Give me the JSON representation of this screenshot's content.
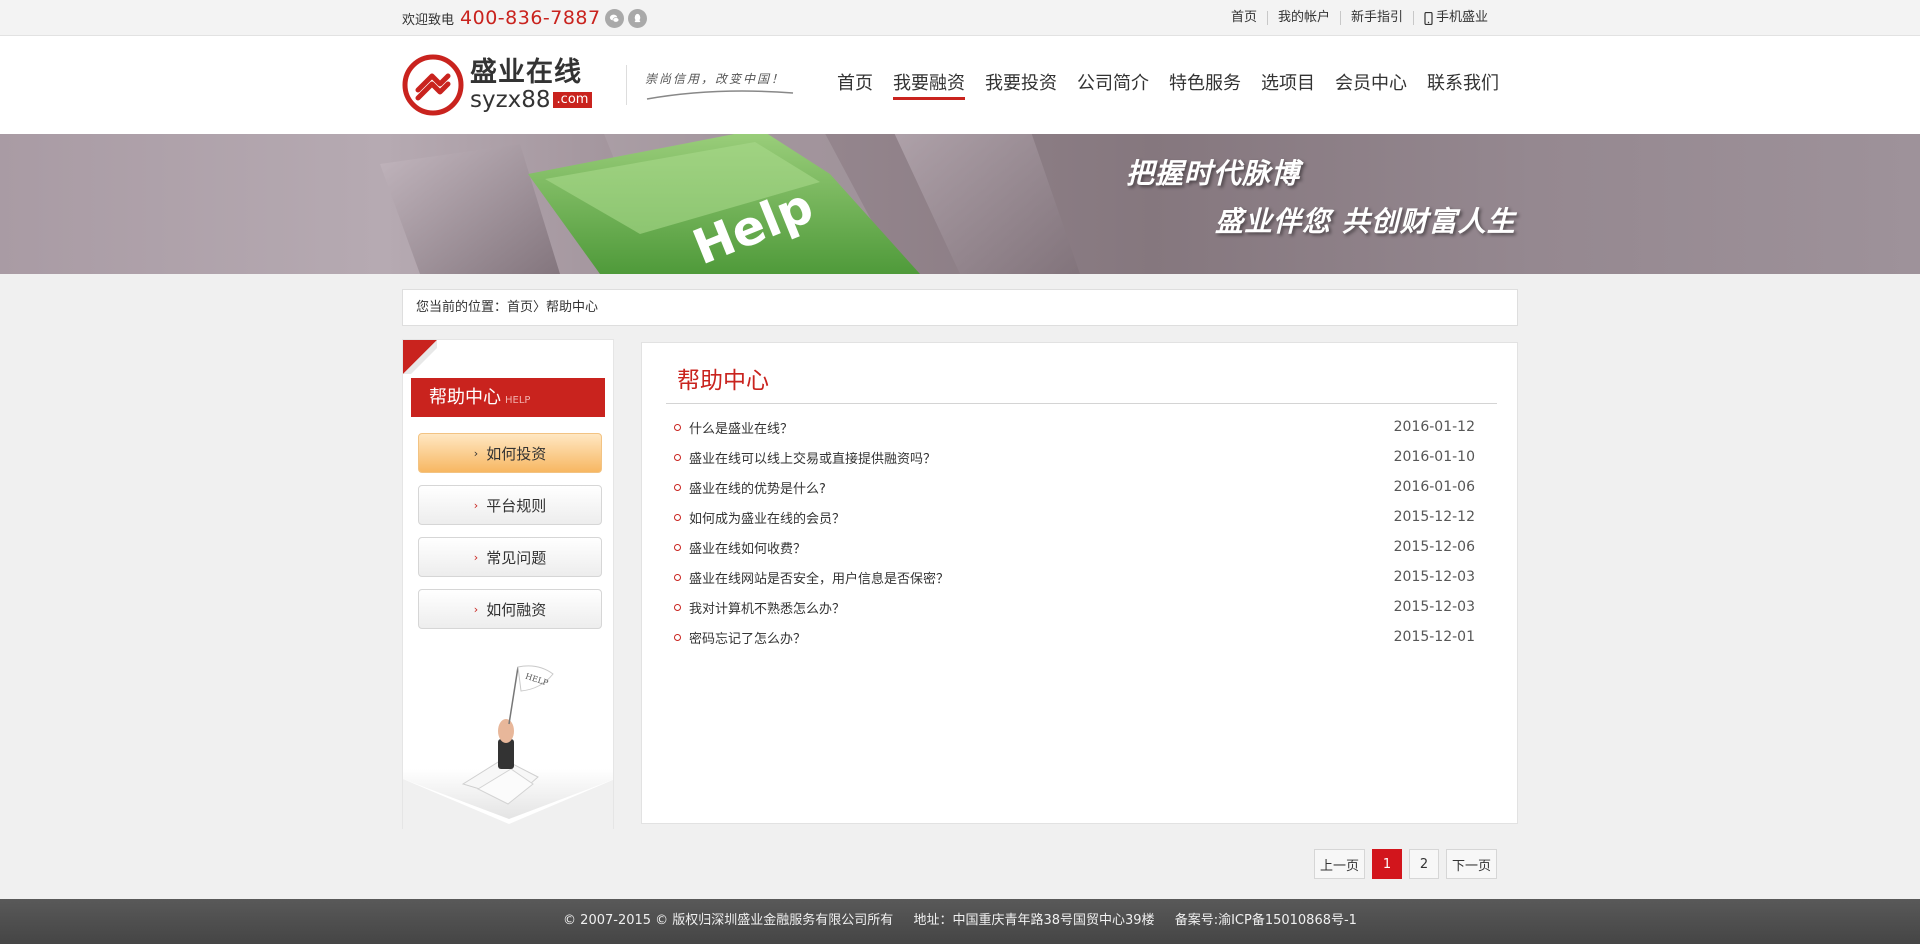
{
  "topbar": {
    "welcome": "欢迎致电",
    "phone": "400-836-7887",
    "links": [
      "首页",
      "我的帐户",
      "新手指引",
      "手机盛业"
    ]
  },
  "logo": {
    "cn": "盛业在线",
    "en": "syzx88",
    "com": ".com",
    "slogan": "崇尚信用，改变中国！"
  },
  "nav": {
    "items": [
      "首页",
      "我要融资",
      "我要投资",
      "公司简介",
      "特色服务",
      "选项目",
      "会员中心",
      "联系我们"
    ],
    "active_index": 1
  },
  "banner": {
    "key_label": "Help",
    "line1": "把握时代脉博",
    "line2": "盛业伴您  共创财富人生"
  },
  "breadcrumb": "您当前的位置：首页〉帮助中心",
  "sidebar": {
    "title": "帮助中心",
    "title_en": "HELP",
    "flag_label": "HELP",
    "menu": [
      "如何投资",
      "平台规则",
      "常见问题",
      "如何融资"
    ]
  },
  "main": {
    "title": "帮助中心",
    "items": [
      {
        "title": "什么是盛业在线？",
        "date": "2016-01-12"
      },
      {
        "title": "盛业在线可以线上交易或直接提供融资吗？",
        "date": "2016-01-10"
      },
      {
        "title": "盛业在线的优势是什么?",
        "date": "2016-01-06"
      },
      {
        "title": "如何成为盛业在线的会员？",
        "date": "2015-12-12"
      },
      {
        "title": "盛业在线如何收费？",
        "date": "2015-12-06"
      },
      {
        "title": "盛业在线网站是否安全，用户信息是否保密？",
        "date": "2015-12-03"
      },
      {
        "title": "我对计算机不熟悉怎么办？",
        "date": "2015-12-03"
      },
      {
        "title": "密码忘记了怎么办？",
        "date": "2015-12-01"
      }
    ]
  },
  "pager": {
    "prev": "上一页",
    "pages": [
      "1",
      "2"
    ],
    "current": "1",
    "next": "下一页"
  },
  "footer": {
    "copyright": "© 2007-2015 © 版权归深圳盛业金融服务有限公司所有",
    "address": "地址：中国重庆青年路38号国贸中心39楼",
    "icp": "备案号:渝ICP备15010868号-1"
  },
  "colors": {
    "brand_red": "#c9231e",
    "active_orange": "#f7b762",
    "footer_bg": "#4f4f4f"
  }
}
